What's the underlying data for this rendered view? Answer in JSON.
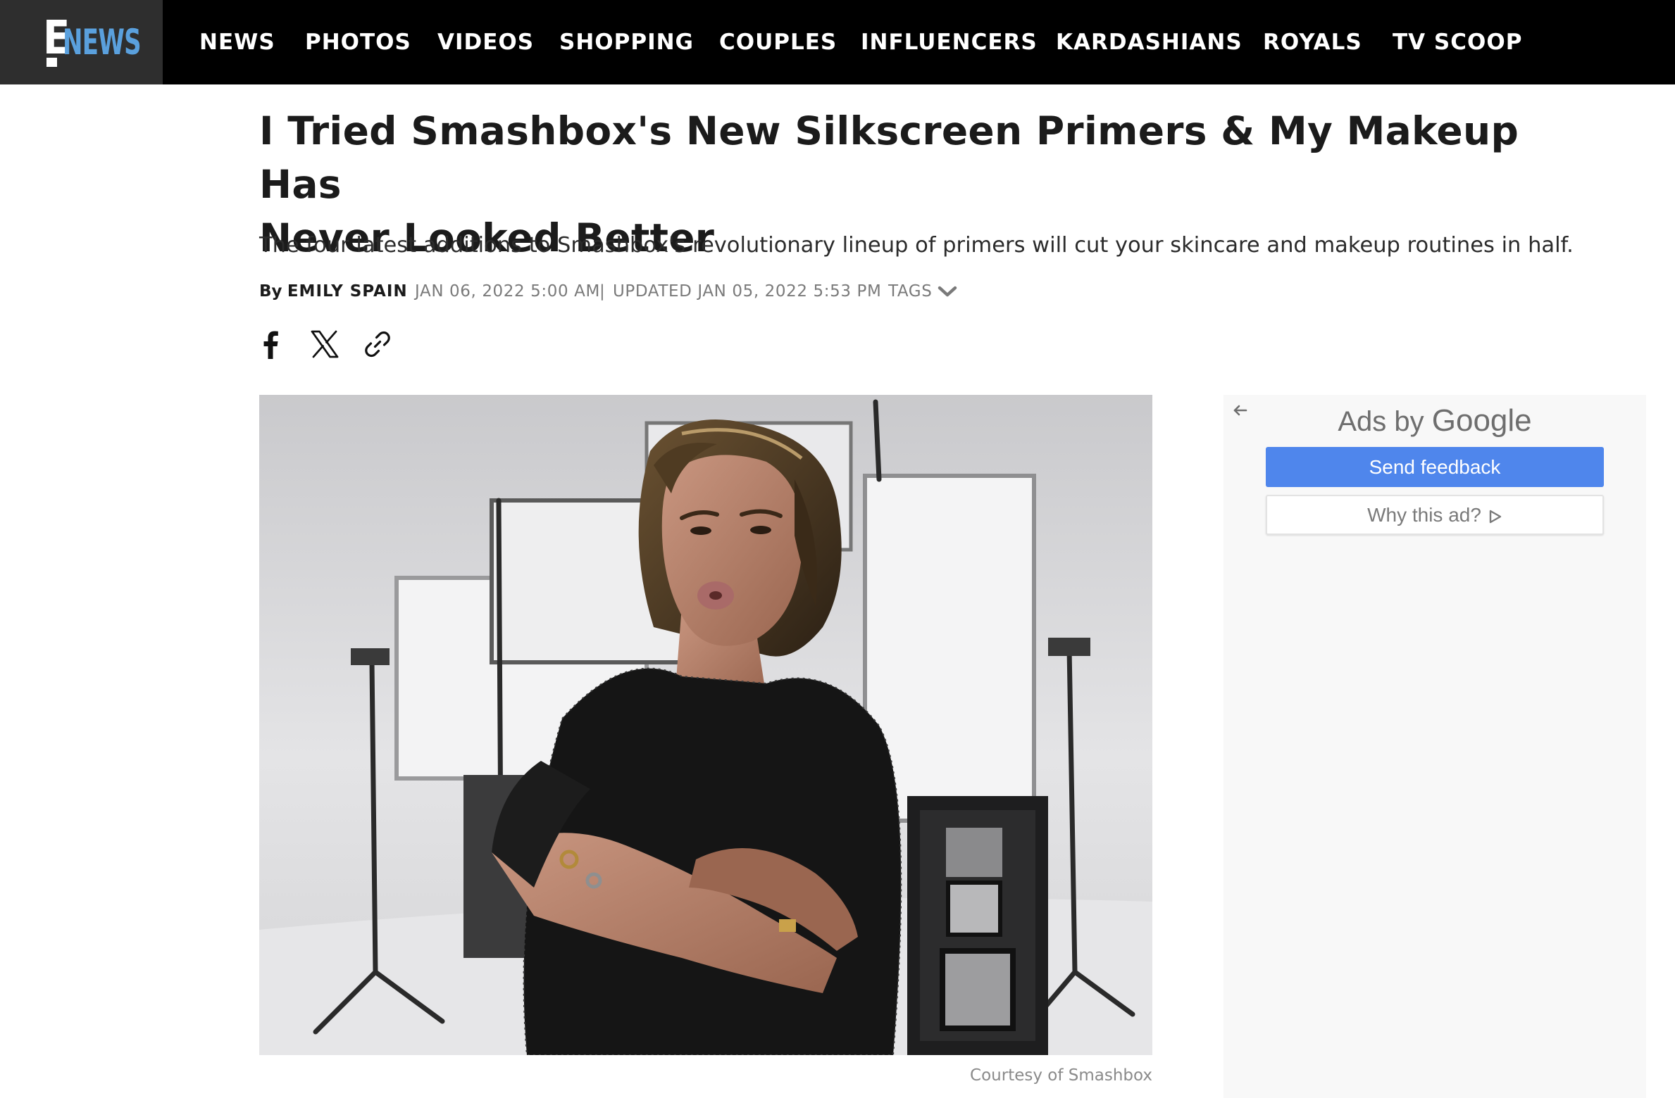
{
  "colors": {
    "nav_bg": "#000000",
    "logo_bg": "#2e2e2e",
    "logo_accent": "#5aa0dd",
    "ad_button": "#4f86ec"
  },
  "logo": {
    "letter": "E",
    "wordmark": "NEWS"
  },
  "nav": {
    "items": [
      {
        "label": "NEWS"
      },
      {
        "label": "PHOTOS"
      },
      {
        "label": "VIDEOS"
      },
      {
        "label": "SHOPPING"
      },
      {
        "label": "COUPLES"
      },
      {
        "label": "INFLUENCERS"
      },
      {
        "label": "KARDASHIANS"
      },
      {
        "label": "ROYALS"
      },
      {
        "label": "TV SCOOP"
      }
    ]
  },
  "article": {
    "headline_line1": "I Tried Smashbox's New Silkscreen Primers & My Makeup Has",
    "headline_line2": "Never Looked Better",
    "dek": "The four latest additions to Smashbox's revolutionary lineup of primers will cut your skincare and makeup routines in half.",
    "by_prefix": "By",
    "author": "EMILY SPAIN",
    "published": "JAN 06, 2022 5:00 AM",
    "separator": "|",
    "updated": "UPDATED JAN 05, 2022 5:53 PM",
    "tags_label": "TAGS",
    "share_icons": [
      "facebook-icon",
      "x-icon",
      "link-icon"
    ],
    "image_caption": "Courtesy of Smashbox"
  },
  "ad": {
    "title_prefix": "Ads by",
    "title_brand": "Google",
    "send_feedback": "Send feedback",
    "why_this_ad": "Why this ad?"
  }
}
